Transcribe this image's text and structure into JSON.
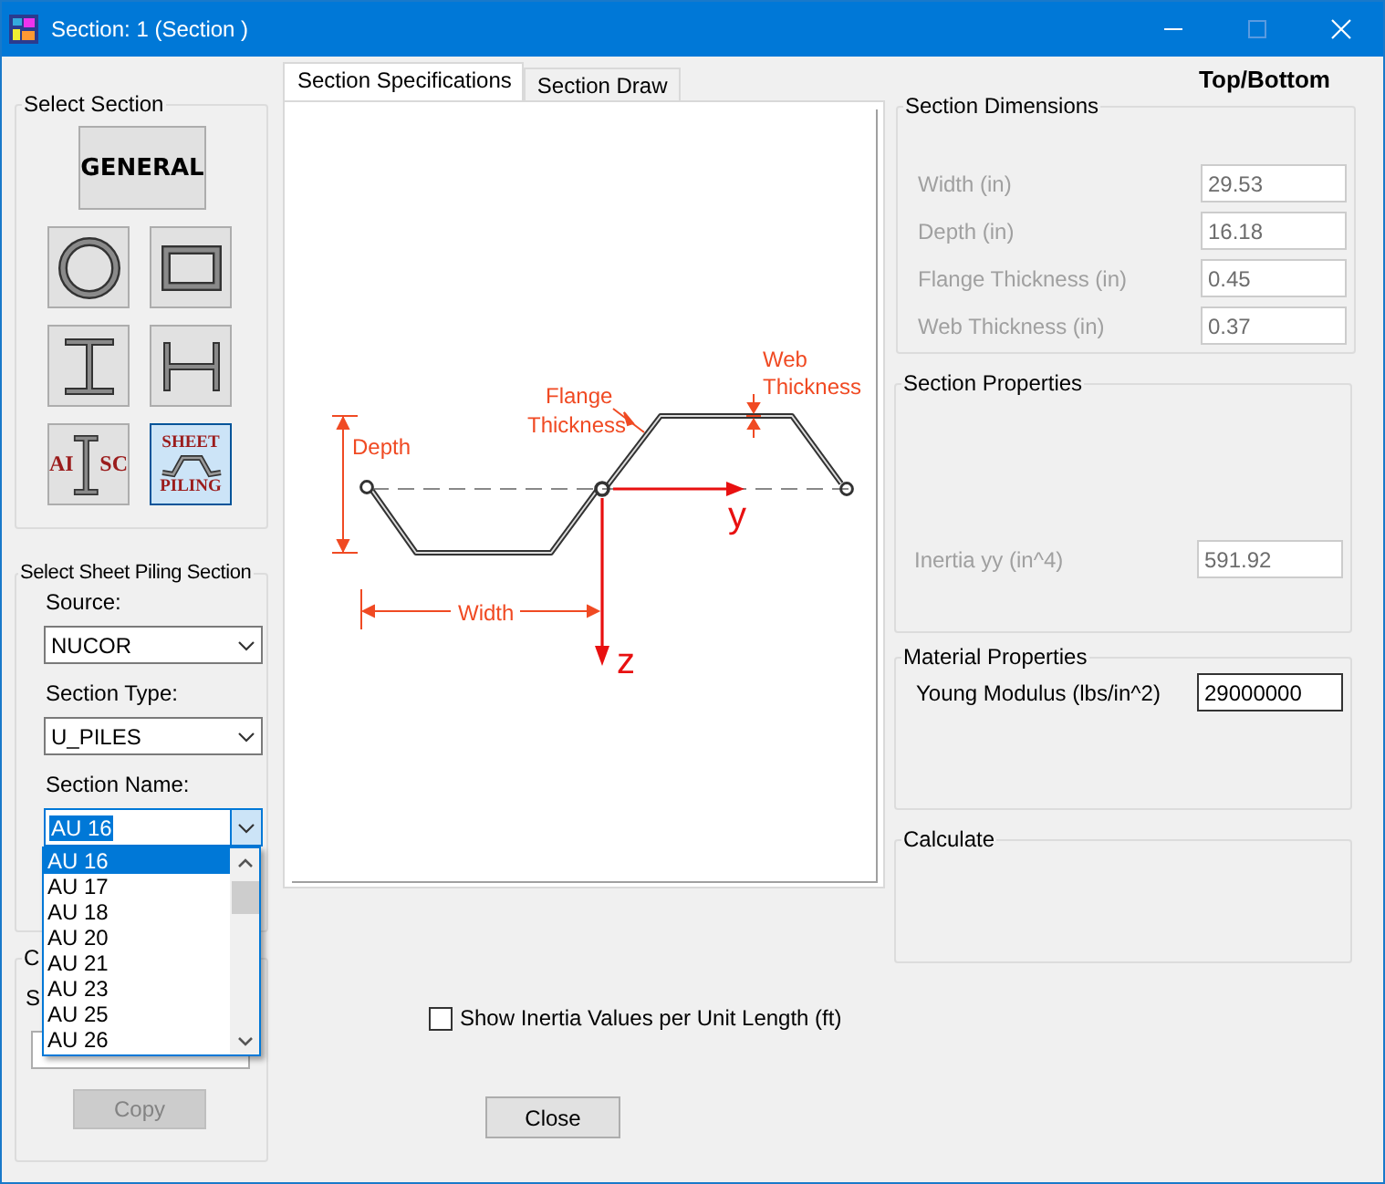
{
  "window": {
    "title": "Section: 1 (Section )"
  },
  "select_section": {
    "title": "Select Section",
    "buttons": [
      {
        "kind": "general",
        "label": "GENERAL",
        "selected": false
      },
      {
        "kind": "circle",
        "selected": false
      },
      {
        "kind": "rectangle",
        "selected": false
      },
      {
        "kind": "i-beam",
        "selected": false
      },
      {
        "kind": "h-beam",
        "selected": false
      },
      {
        "kind": "aisc",
        "label_left": "AI",
        "label_right": "SC",
        "selected": false
      },
      {
        "kind": "sheet-piling",
        "label_top": "SHEET",
        "label_bottom": "PILING",
        "selected": true
      }
    ]
  },
  "sheet_piling": {
    "title": "Select Sheet Piling Section",
    "fields": [
      {
        "label": "Source:",
        "value": "NUCOR",
        "expanded": false
      },
      {
        "label": "Section Type:",
        "value": "U_PILES",
        "expanded": false
      },
      {
        "label": "Section Name:",
        "value": "AU 16",
        "expanded": true,
        "options": [
          {
            "label": "AU 16",
            "selected": true
          },
          {
            "label": "AU 17",
            "selected": false
          },
          {
            "label": "AU 18",
            "selected": false
          },
          {
            "label": "AU 20",
            "selected": false
          },
          {
            "label": "AU 21",
            "selected": false
          },
          {
            "label": "AU 23",
            "selected": false
          },
          {
            "label": "AU 25",
            "selected": false
          },
          {
            "label": "AU 26",
            "selected": false
          }
        ]
      }
    ]
  },
  "copy_group": {
    "title": "C",
    "label": "S",
    "button": {
      "label": "Copy",
      "disabled": true
    }
  },
  "tabs": [
    {
      "label": "Section Specifications",
      "selected": true
    },
    {
      "label": "Section Draw",
      "selected": false
    }
  ],
  "diagram": {
    "labels": [
      {
        "kind": "depth",
        "text": "Depth"
      },
      {
        "kind": "width",
        "text": "Width"
      },
      {
        "kind": "flange",
        "text": "Flange Thickness"
      },
      {
        "kind": "web",
        "text": "Web Thickness"
      },
      {
        "kind": "y-axis",
        "text": "y"
      },
      {
        "kind": "z-axis",
        "text": "z"
      }
    ]
  },
  "inertia_option": {
    "label": "Show Inertia Values per Unit Length (ft)",
    "checked": false
  },
  "close_button": {
    "label": "Close"
  },
  "heading": "Top/Bottom",
  "section_dimensions": {
    "title": "Section Dimensions",
    "fields": [
      {
        "label": "Width (in)",
        "value": "29.53",
        "disabled": true
      },
      {
        "label": "Depth (in)",
        "value": "16.18",
        "disabled": true
      },
      {
        "label": "Flange Thickness (in)",
        "value": "0.45",
        "disabled": true
      },
      {
        "label": "Web Thickness (in)",
        "value": "0.37",
        "disabled": true
      }
    ]
  },
  "section_properties": {
    "title": "Section Properties",
    "fields": [
      {
        "label": "Inertia yy (in^4)",
        "value": "591.92",
        "disabled": true
      }
    ]
  },
  "material_properties": {
    "title": "Material Properties",
    "fields": [
      {
        "label": "Young Modulus (lbs/in^2)",
        "value": "29000000",
        "disabled": false
      }
    ]
  },
  "calculate": {
    "title": "Calculate"
  }
}
